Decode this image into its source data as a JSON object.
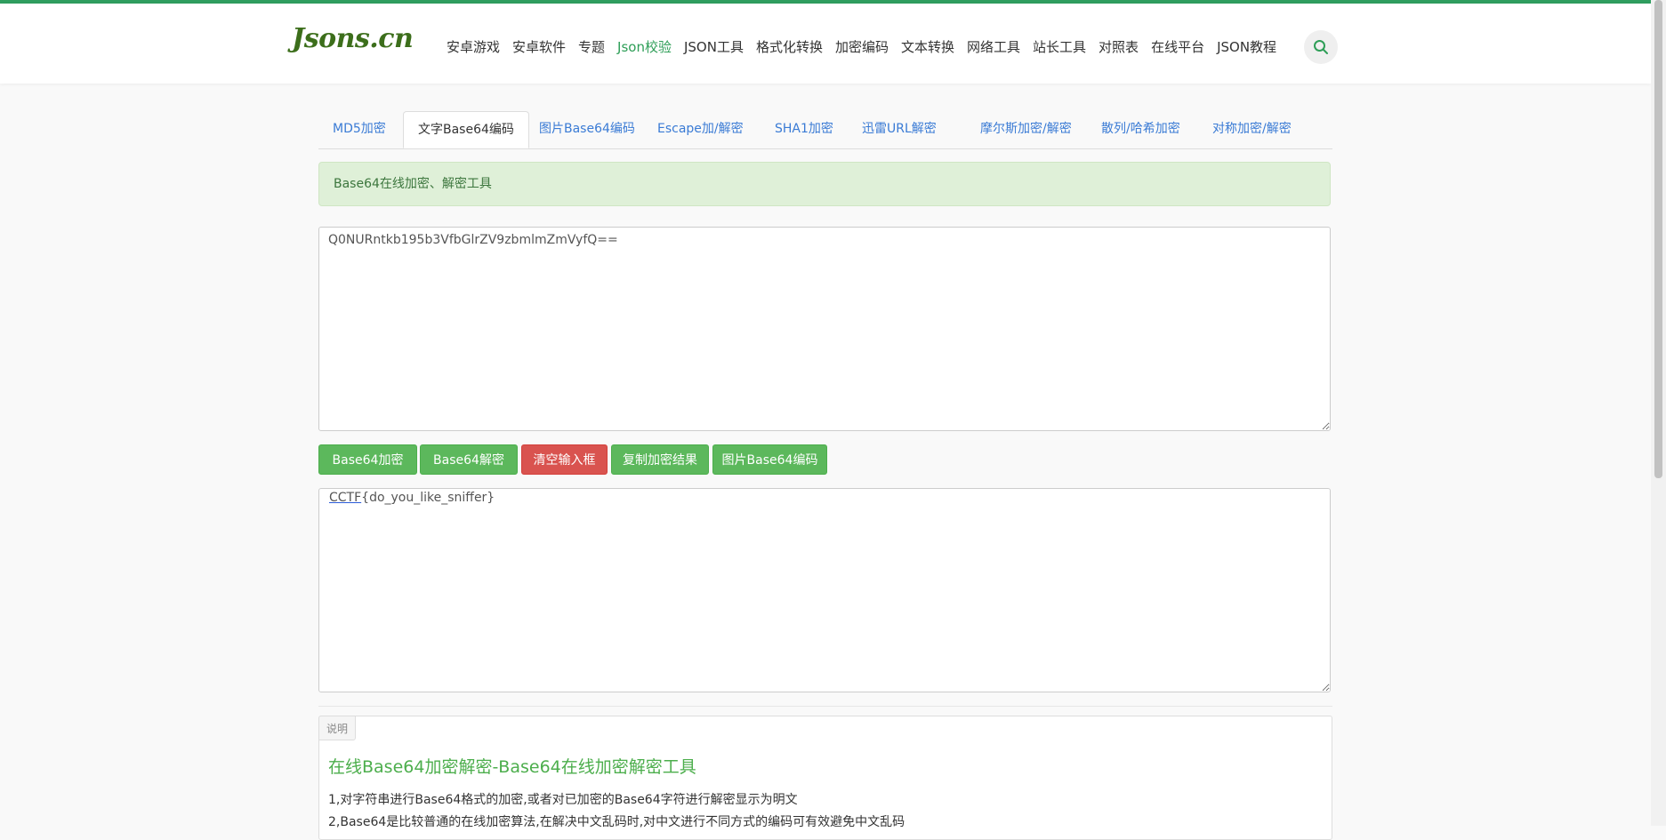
{
  "brand": {
    "logo_text": "Jsons.cn",
    "accent_color": "#2e9e57"
  },
  "nav": {
    "items": [
      "安卓游戏",
      "安卓软件",
      "专题",
      "Json校验",
      "JSON工具",
      "格式化转换",
      "加密编码",
      "文本转换",
      "网络工具",
      "站长工具",
      "对照表",
      "在线平台",
      "JSON教程"
    ],
    "active_index": 3,
    "search_icon": "search-icon"
  },
  "tabs": {
    "items": [
      "MD5加密",
      "文字Base64编码",
      "图片Base64编码",
      "Escape加/解密",
      "SHA1加密",
      "迅雷URL解密",
      "摩尔斯加密/解密",
      "散列/哈希加密",
      "对称加密/解密"
    ],
    "active_index": 1
  },
  "alert": {
    "text": "Base64在线加密、解密工具"
  },
  "input": {
    "value": "Q0NURntkb195b3VfbGlrZV9zbmlmZmVyfQ=="
  },
  "buttons": {
    "encode": "Base64加密",
    "decode": "Base64解密",
    "clear": "清空输入框",
    "copy": "复制加密结果",
    "image": "图片Base64编码"
  },
  "output": {
    "value_prefix": "CCTF",
    "value_rest": "{do_you_like_sniffer}",
    "value": "CCTF{do_you_like_sniffer}"
  },
  "description": {
    "tag": "说明",
    "title": "在线Base64加密解密-Base64在线加密解密工具",
    "lines": [
      "1,对字符串进行Base64格式的加密,或者对已加密的Base64字符进行解密显示为明文",
      "2,Base64是比较普通的在线加密算法,在解决中文乱码时,对中文进行不同方式的编码可有效避免中文乱码"
    ]
  }
}
